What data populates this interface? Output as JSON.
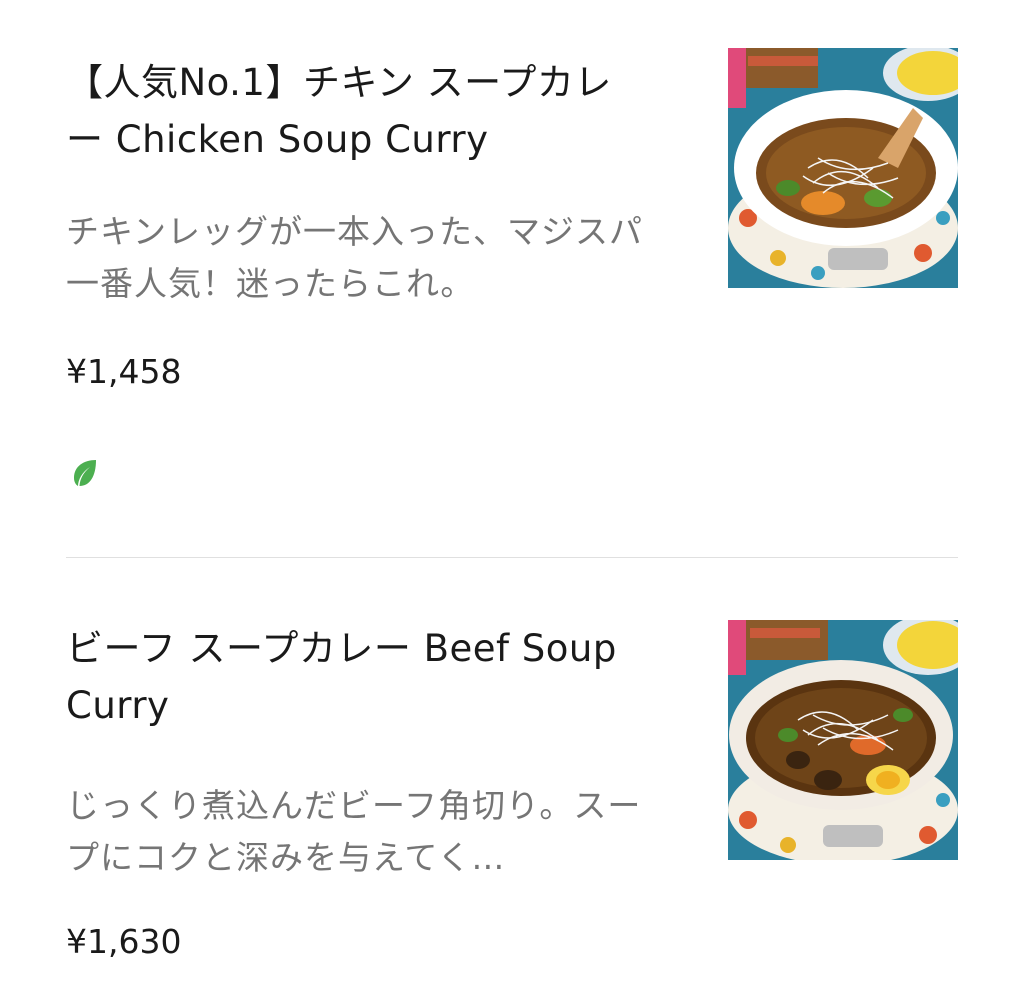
{
  "menu": {
    "items": [
      {
        "title": "【人気No.1】チキン スープカレー Chicken Soup Curry",
        "description": "チキンレッグが一本入った、マジスパ一番人気！迷ったらこれ。",
        "price": "¥1,458",
        "badge_icon": "leaf-icon",
        "badge_color": "#4caf50"
      },
      {
        "title": "ビーフ スープカレー Beef Soup Curry",
        "description": "じっくり煮込んだビーフ角切り。スープにコクと深みを与えてく…",
        "price": "¥1,630"
      }
    ]
  }
}
